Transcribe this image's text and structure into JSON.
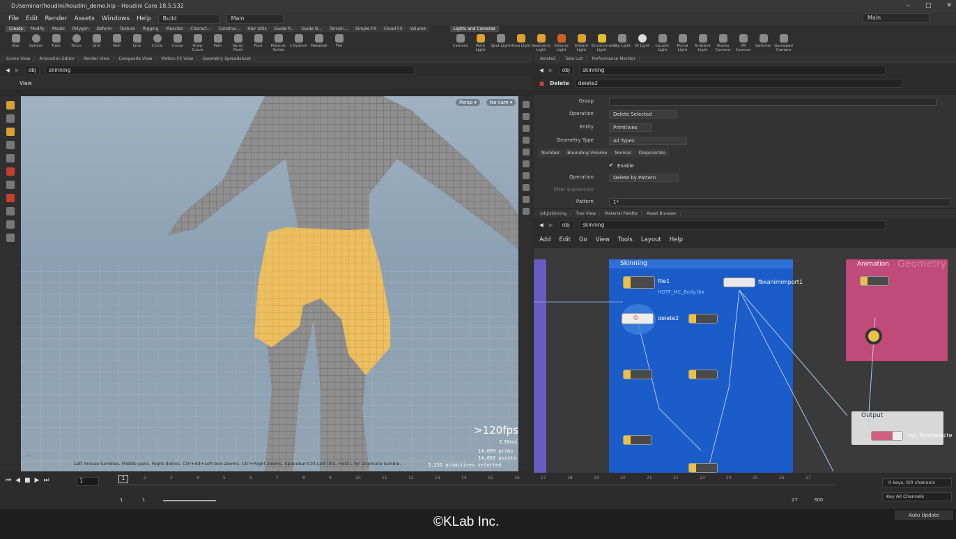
{
  "window": {
    "title": "D:/seminar/houdini/houdini_demo.hip - Houdini Core 18.5.532",
    "controls": [
      "–",
      "□",
      "✕"
    ]
  },
  "menu": {
    "items": [
      "File",
      "Edit",
      "Render",
      "Assets",
      "Windows",
      "Help"
    ],
    "build": "Build",
    "desktop": "Main",
    "right_desktop": "Main"
  },
  "shelf": {
    "tabs": [
      "Create",
      "Modify",
      "Model",
      "Polygon",
      "Deform",
      "Texture",
      "Rigging",
      "Muscles",
      "Charact...",
      "Constrai...",
      "Hair Utils",
      "Guide P...",
      "Guide B...",
      "Terrain...",
      "Simple FX",
      "Cloud FX",
      "Volume"
    ],
    "tools": [
      "Box",
      "Sphere",
      "Tube",
      "Torus",
      "Grid",
      "Null",
      "Line",
      "Circle",
      "Curve",
      "Draw Curve",
      "Path",
      "Spray Paint",
      "Font",
      "Platonic Solids",
      "L-System",
      "Metaball",
      "File"
    ],
    "light_tab": "Lights and Cameras",
    "light_tools": [
      "Camera",
      "Point Light",
      "Spot Light",
      "Area Light",
      "Geometry Light",
      "Volume Light",
      "Distant Light",
      "Environment Light",
      "Sky Light",
      "GI Light",
      "Caustic Light",
      "Portal Light",
      "Ambient Light",
      "Stereo Camera",
      "VR Camera",
      "Switcher",
      "Gamepad Camera"
    ]
  },
  "left_pane": {
    "tabs": [
      "Scene View",
      "Animation Editor",
      "Render View",
      "Composite View",
      "Motion FX View",
      "Geometry Spreadsheet"
    ],
    "path_root": "obj",
    "path_node": "skinning",
    "view_label": "View",
    "persp": "Persp ▾",
    "cam": "No cam ▾",
    "fps": ">120fps",
    "ms": "2.36ms",
    "prims": "14,609  prims",
    "points": "14,602  points",
    "selected": "3,232  primitives selected",
    "hint": "Left mouse tumbles. Middle pans. Right dollies. Ctrl+Alt+Left box-zooms. Ctrl+Right zooms. Spacebar-Ctrl-Left tilts. Hold L for alternate tumble."
  },
  "param_pane": {
    "tabs": [
      "delete2",
      "Take List",
      "Performance Monitor"
    ],
    "path_root": "obj",
    "path_node": "skinning",
    "node_type": "Delete",
    "node_name": "delete2",
    "rows": {
      "group": "Group",
      "operation": "Operation",
      "operation_val": "Delete Selected",
      "entity": "Entity",
      "entity_val": "Primitives",
      "geotype": "Geometry Type",
      "geotype_val": "All Types"
    },
    "subtabs": [
      "Number",
      "Bounding Volume",
      "Normal",
      "Degenerate"
    ],
    "enable": "Enable",
    "op2": "Operation",
    "op2_val": "Delete by Pattern",
    "filter": "Filter Expression",
    "pattern": "Pattern",
    "pattern_val": "1*"
  },
  "net_pane": {
    "tabs": [
      "/obj/skinning",
      "Tree View",
      "Material Palette",
      "Asset Browser"
    ],
    "path_root": "obj",
    "path_node": "skinning",
    "menu": [
      "Add",
      "Edit",
      "Go",
      "View",
      "Tools",
      "Layout",
      "Help"
    ],
    "boxes": {
      "skinning": "Skinning",
      "animation": "Animation",
      "output": "Output",
      "watermark": "Geometry"
    },
    "nodes": {
      "file1": "file1",
      "file1_sub": "HOTF_MC_Body.fbx",
      "delete2": "delete2",
      "fbx": "fbxanimimport1",
      "rop": "rop_fbxcharacte"
    }
  },
  "timeline": {
    "frame": "1",
    "ticks": [
      "2",
      "3",
      "4",
      "5",
      "6",
      "7",
      "8",
      "9",
      "10",
      "11",
      "12",
      "13",
      "14",
      "15",
      "16",
      "17",
      "18",
      "19",
      "20",
      "21",
      "22",
      "23",
      "24",
      "25",
      "26",
      "27"
    ],
    "start": "1",
    "start2": "1",
    "end": "27",
    "end2": "300",
    "keys": "0 keys, 0/0 channels",
    "key_all": "Key All Channels",
    "auto_update": "Auto Update"
  },
  "copyright": "©KLab Inc."
}
